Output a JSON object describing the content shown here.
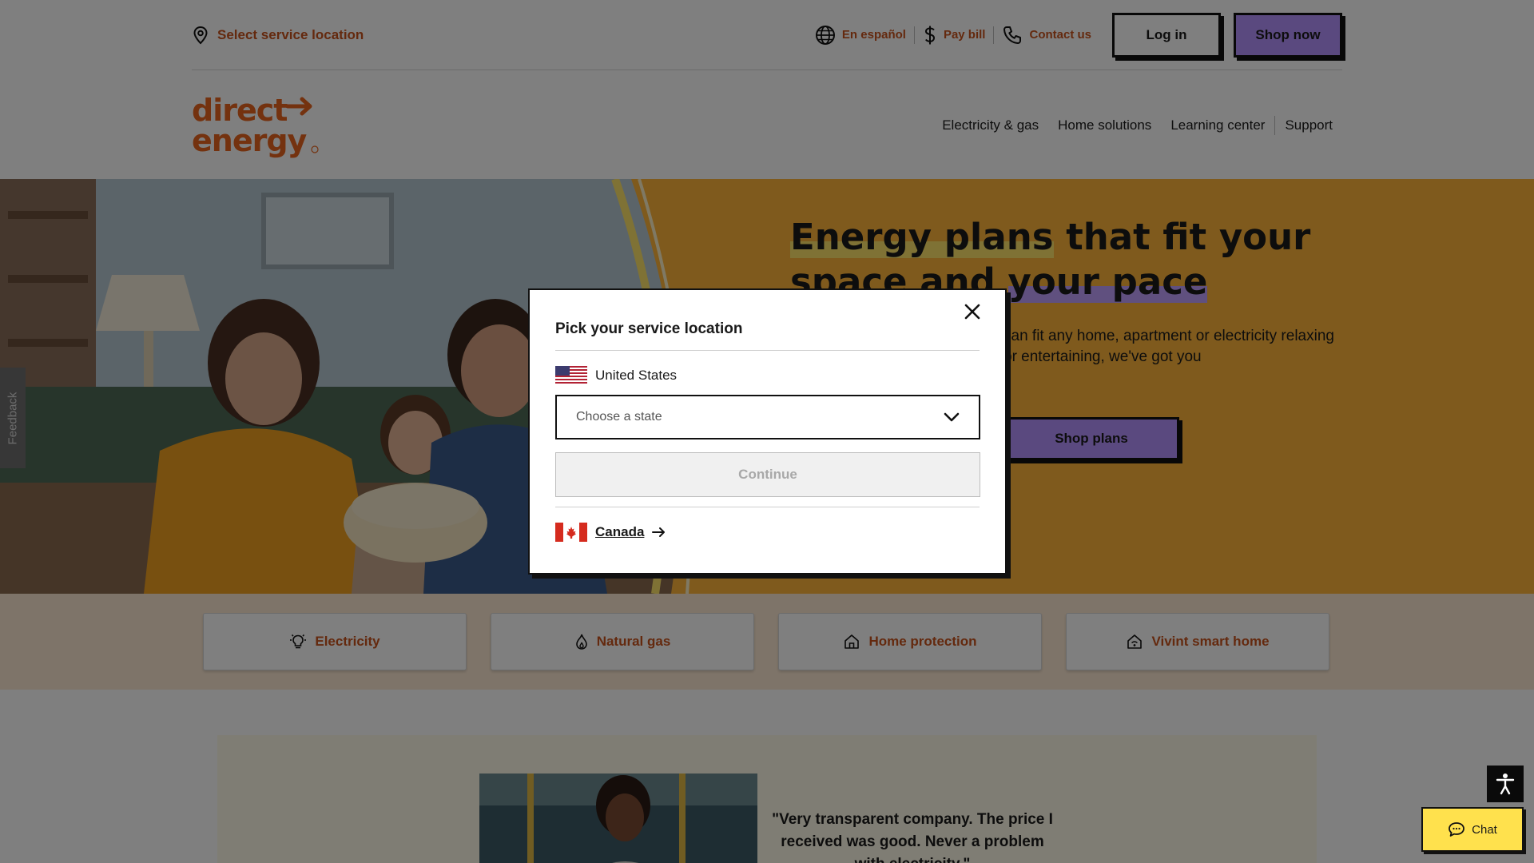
{
  "utility": {
    "location_label": "Select service location",
    "spanish_label": "En español",
    "pay_bill_label": "Pay bill",
    "contact_label": "Contact us",
    "login_label": "Log in",
    "shop_now_label": "Shop now"
  },
  "nav": {
    "logo_line1": "direct",
    "logo_line2": "energy",
    "items": [
      "Electricity & gas",
      "Home solutions",
      "Learning center",
      "Support"
    ]
  },
  "hero": {
    "title_part1": "Energy plans",
    "title_part2": " that fit your space and ",
    "title_part3": "your pace",
    "description": "can fit any home, apartment or electricity relaxing or entertaining, we've got you",
    "cta_label": "Shop plans"
  },
  "feedback_label": "Feedback",
  "categories": [
    {
      "label": "Electricity",
      "icon": "lightbulb-icon"
    },
    {
      "label": "Natural gas",
      "icon": "flame-icon"
    },
    {
      "label": "Home protection",
      "icon": "house-shield-icon"
    },
    {
      "label": "Vivint smart home",
      "icon": "smart-home-icon"
    }
  ],
  "testimonial": {
    "quote": "\"Very transparent company. The price I received was good. Never a problem with electricity.\""
  },
  "modal": {
    "title": "Pick your service location",
    "country": "United States",
    "state_placeholder": "Choose a state",
    "continue_label": "Continue",
    "alt_country": "Canada"
  },
  "chat_label": "Chat",
  "colors": {
    "brand_orange": "#c8531c",
    "hero_bg": "#ffb43a",
    "purple": "#b592ff",
    "chat_yellow": "#ffe14d"
  }
}
